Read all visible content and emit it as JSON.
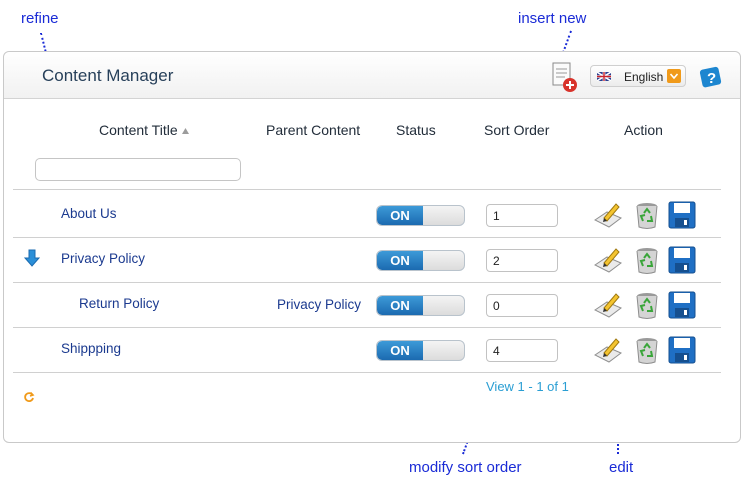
{
  "annotations": {
    "refine": "refine",
    "insert_new": "insert new",
    "modify_sort_order": "modify sort order",
    "edit": "edit"
  },
  "header": {
    "title": "Content Manager",
    "language": "English",
    "icons": [
      "insert-new-icon",
      "uk-flag-icon",
      "dropdown-arrow-icon",
      "help-icon"
    ]
  },
  "table": {
    "columns": [
      "Content Title",
      "Parent Content",
      "Status",
      "Sort Order",
      "Action"
    ],
    "filter_value": "",
    "rows": [
      {
        "title": "About Us",
        "parent": "",
        "status": "ON",
        "sort": "1"
      },
      {
        "title": "Privacy Policy",
        "parent": "",
        "status": "ON",
        "sort": "2"
      },
      {
        "title": "Return Policy",
        "parent": "Privacy Policy",
        "status": "ON",
        "sort": "0"
      },
      {
        "title": "Shippping",
        "parent": "",
        "status": "ON",
        "sort": "4"
      }
    ],
    "action_icons": [
      "edit-icon",
      "recycle-delete-icon",
      "save-icon"
    ]
  },
  "pager": "View 1 - 1 of 1",
  "colors": {
    "annotation": "#1a2bd6",
    "toggle_on": "#1b6ab0",
    "pager": "#2a9ed3",
    "link": "#1b3a8f"
  }
}
